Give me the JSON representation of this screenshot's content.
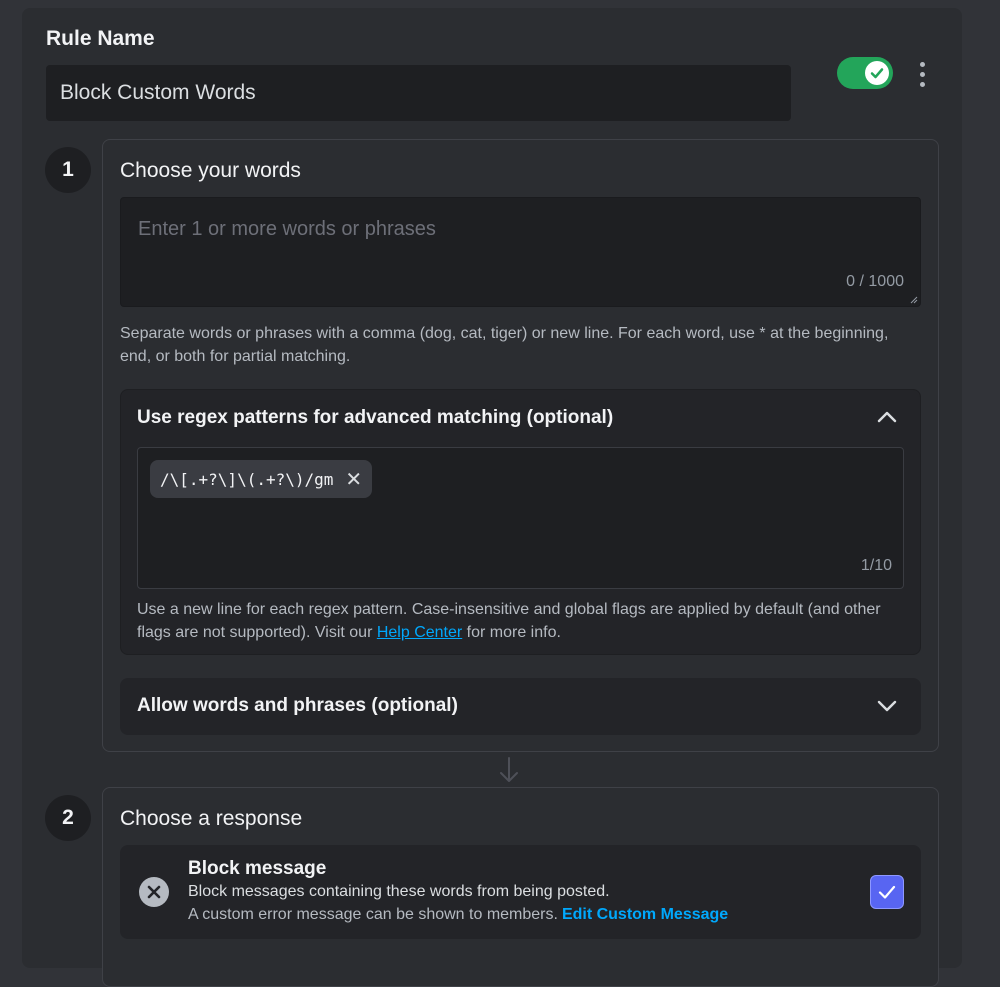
{
  "rule": {
    "label": "Rule Name",
    "name_value": "Block Custom Words",
    "enabled": true
  },
  "step1": {
    "number": "1",
    "title": "Choose your words",
    "words_placeholder": "Enter 1 or more words or phrases",
    "words_counter": "0 / 1000",
    "help_line1": "Separate words or phrases with a comma (dog, cat, tiger) or new line. For each word, use * at the beginning,",
    "help_line2": "end, or both for partial matching.",
    "regex": {
      "title": "Use regex patterns for advanced matching (optional)",
      "chip": "/\\[.+?\\]\\(.+?\\)/gm",
      "counter": "1/10",
      "help_line1": "Use a new line for each regex pattern. Case-insensitive and global flags are applied by default (and other",
      "help_line2_pre": "flags are not supported). Visit our ",
      "help_link": "Help Center",
      "help_line2_post": " for more info."
    },
    "allow": {
      "title": "Allow words and phrases (optional)"
    }
  },
  "step2": {
    "number": "2",
    "title": "Choose a response",
    "block": {
      "title": "Block message",
      "description": "Block messages containing these words from being posted.",
      "sub": "A custom error message can be shown to members.",
      "link": "Edit Custom Message",
      "checked": true
    }
  },
  "colors": {
    "toggle_on": "#23a55a",
    "checkbox": "#5865f2",
    "link": "#00a8fc",
    "background": "#313338",
    "panel": "#2b2d31"
  },
  "icons": [
    "check-icon",
    "more-vertical-icon",
    "chevron-up-icon",
    "chevron-down-icon",
    "close-icon",
    "arrow-down-icon",
    "x-circle-icon"
  ]
}
